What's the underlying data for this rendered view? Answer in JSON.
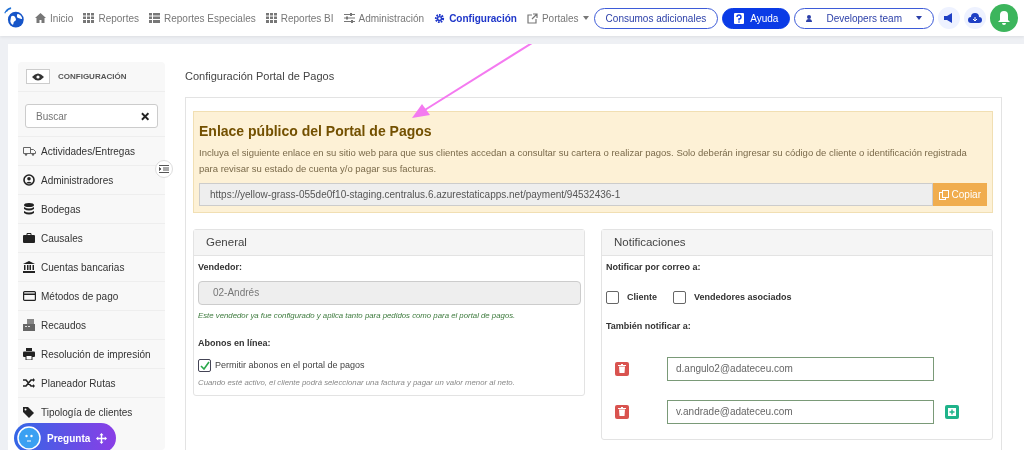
{
  "navbar": {
    "items": [
      {
        "label": "Inicio",
        "selected": false
      },
      {
        "label": "Reportes",
        "selected": false
      },
      {
        "label": "Reportes Especiales",
        "selected": false
      },
      {
        "label": "Reportes BI",
        "selected": false
      },
      {
        "label": "Administración",
        "selected": false
      },
      {
        "label": "Configuración",
        "selected": true
      },
      {
        "label": "Portales",
        "selected": false
      }
    ],
    "consumos_button": "Consumos adicionales",
    "help_button": "Ayuda",
    "team_dropdown": "Developers team"
  },
  "sidebar": {
    "title": "CONFIGURACIÓN",
    "search": {
      "placeholder": "Buscar"
    },
    "items": [
      {
        "label": "Actividades/Entregas"
      },
      {
        "label": "Administradores"
      },
      {
        "label": "Bodegas"
      },
      {
        "label": "Causales"
      },
      {
        "label": "Cuentas bancarias"
      },
      {
        "label": "Métodos de pago"
      },
      {
        "label": "Recaudos"
      },
      {
        "label": "Resolución de impresión"
      },
      {
        "label": "Planeador Rutas"
      },
      {
        "label": "Tipología de clientes"
      }
    ]
  },
  "chat_button": "Pregunta",
  "page_title": "Configuración Portal de Pagos",
  "public_link": {
    "title": "Enlace público del Portal de Pagos",
    "description": "Incluya el siguiente enlace en su sitio web para que sus clientes accedan a consultar su cartera o realizar pagos. Solo deberán ingresar su código de cliente o identificación registrada para revisar su estado de cuenta y/o pagar sus facturas.",
    "url": "https://yellow-grass-055de0f10-staging.centralus.6.azurestaticapps.net/payment/94532436-1",
    "copy_button": "Copiar"
  },
  "general": {
    "title": "General",
    "seller_label": "Vendedor:",
    "seller_value": "02-Andrés",
    "seller_note": "Este vendedor ya fue configurado y aplica tanto para pedidos como para el portal de pagos.",
    "payments_label": "Abonos en línea:",
    "allow_partial": {
      "label": "Permitir abonos en el portal de pagos",
      "checked": true
    },
    "partial_note": "Cuando esté activo, el cliente podrá seleccionar una factura y pagar un valor menor al neto."
  },
  "notifications": {
    "title": "Notificaciones",
    "email_label": "Notificar por correo a:",
    "options": [
      {
        "label": "Cliente",
        "checked": false
      },
      {
        "label": "Vendedores asociados",
        "checked": false
      }
    ],
    "also_label": "También notificar a:",
    "emails": [
      {
        "value": "d.angulo2@adateceu.com",
        "can_add": false
      },
      {
        "value": "v.andrade@adateceu.com",
        "can_add": true
      }
    ]
  }
}
